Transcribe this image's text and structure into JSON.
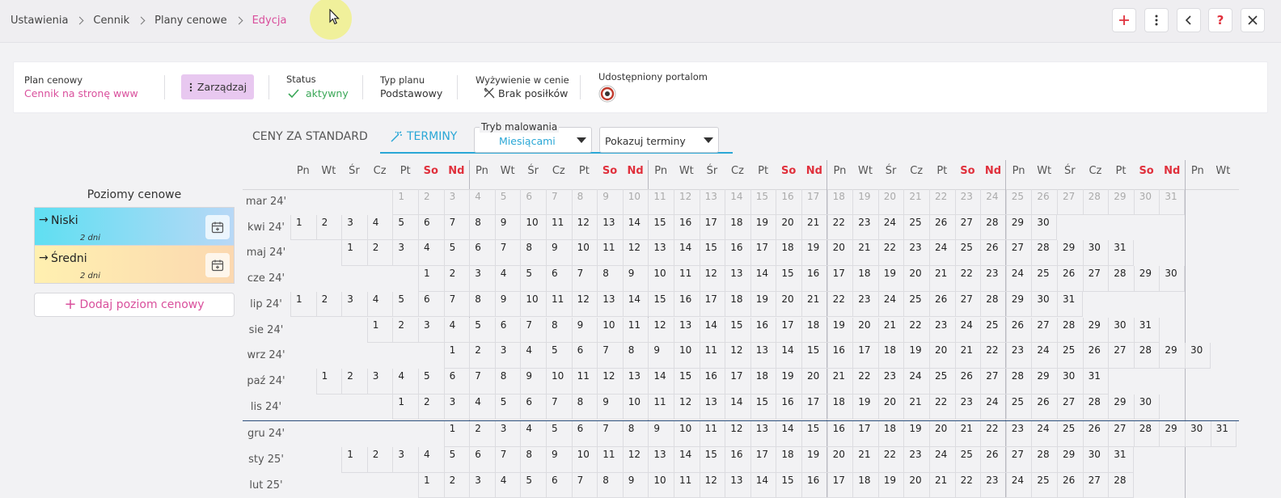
{
  "breadcrumb": [
    "Ustawienia",
    "Cennik",
    "Plany cenowe",
    "Edycja"
  ],
  "toolbar": {
    "add_icon": "plus-icon",
    "more_icon": "kebab-icon",
    "back_icon": "chevron-left-icon",
    "help_icon": "question-icon",
    "close_icon": "close-icon"
  },
  "info": {
    "plan_label": "Plan cenowy",
    "plan_value": "Cennik na stronę www",
    "manage_label": "Zarządzaj",
    "status_label": "Status",
    "status_value": "aktywny",
    "type_label": "Typ planu",
    "type_value": "Podstawowy",
    "meal_label": "Wyżywienie w cenie",
    "meal_value": "Brak posiłków",
    "portals_label": "Udostępniony portalom"
  },
  "tabs": {
    "standard": "CENY ZA STANDARD",
    "terms": "TERMINY"
  },
  "paint_mode": {
    "label": "Tryb malowania",
    "value": "Miesiącami"
  },
  "show_select": {
    "value": "Pokazuj terminy"
  },
  "levels": {
    "title": "Poziomy cenowe",
    "items": [
      {
        "name": "Niski",
        "days": "2 dni"
      },
      {
        "name": "Średni",
        "days": "2 dni"
      }
    ],
    "add_label": "Dodaj poziom cenowy"
  },
  "calendar": {
    "weekday_headers": [
      "Pn",
      "Wt",
      "Śr",
      "Cz",
      "Pt",
      "So",
      "Nd",
      "Pn",
      "Wt",
      "Śr",
      "Cz",
      "Pt",
      "So",
      "Nd",
      "Pn",
      "Wt",
      "Śr",
      "Cz",
      "Pt",
      "So",
      "Nd",
      "Pn",
      "Wt",
      "Śr",
      "Cz",
      "Pt",
      "So",
      "Nd",
      "Pn",
      "Wt",
      "Śr",
      "Cz",
      "Pt",
      "So",
      "Nd",
      "Pn",
      "Wt"
    ],
    "months": [
      {
        "label": "mar 24'",
        "offset": 4,
        "days": 31,
        "muted": true
      },
      {
        "label": "kwi 24'",
        "offset": 0,
        "days": 30,
        "muted": false
      },
      {
        "label": "maj 24'",
        "offset": 2,
        "days": 31,
        "muted": false
      },
      {
        "label": "cze 24'",
        "offset": 5,
        "days": 30,
        "muted": false
      },
      {
        "label": "lip 24'",
        "offset": 0,
        "days": 31,
        "muted": false
      },
      {
        "label": "sie 24'",
        "offset": 3,
        "days": 31,
        "muted": false
      },
      {
        "label": "wrz 24'",
        "offset": 6,
        "days": 30,
        "muted": false
      },
      {
        "label": "paź 24'",
        "offset": 1,
        "days": 31,
        "muted": false
      },
      {
        "label": "lis 24'",
        "offset": 4,
        "days": 30,
        "muted": false
      },
      {
        "label": "gru 24'",
        "offset": 6,
        "days": 31,
        "muted": false
      },
      {
        "label": "sty 25'",
        "offset": 2,
        "days": 31,
        "muted": false
      },
      {
        "label": "lut 25'",
        "offset": 5,
        "days": 28,
        "muted": false
      }
    ]
  },
  "colors": {
    "accent": "#d94f9c",
    "teal": "#2aa7d6",
    "weekend": "#e0303c",
    "status_green": "#3aa757"
  }
}
